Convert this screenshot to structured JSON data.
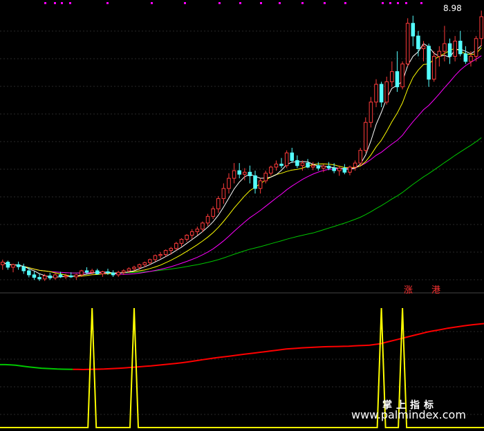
{
  "chart_data": {
    "type": "candlestick",
    "title": "",
    "grid": true,
    "colors": {
      "up": "#ff3b3b",
      "down": "#54ffff",
      "ma5": "#ffffff",
      "ma10": "#ffff00",
      "ma20": "#ff00ff",
      "ma60": "#00c800",
      "indicator_signal": "#ffff00",
      "indicator_line_up": "#ff0000",
      "indicator_line_low": "#00c800",
      "grid": "#2a2a2a"
    },
    "price_label": "8.98",
    "tags": [
      "涨",
      "港"
    ],
    "watermark": {
      "line1": "掌上指标",
      "line2": "www.palmindex.com"
    },
    "price_panel": {
      "y_range": [
        3.6,
        9.2
      ],
      "candles": [
        [
          4.1,
          4.2,
          4.0,
          4.15
        ],
        [
          4.15,
          4.18,
          4.0,
          4.05
        ],
        [
          4.05,
          4.12,
          3.95,
          4.1
        ],
        [
          4.1,
          4.16,
          4.0,
          4.06
        ],
        [
          4.06,
          4.12,
          3.92,
          3.98
        ],
        [
          3.98,
          4.05,
          3.85,
          3.9
        ],
        [
          3.9,
          3.97,
          3.8,
          3.85
        ],
        [
          3.85,
          3.92,
          3.78,
          3.82
        ],
        [
          3.82,
          3.92,
          3.78,
          3.88
        ],
        [
          3.88,
          3.94,
          3.8,
          3.84
        ],
        [
          3.84,
          3.93,
          3.8,
          3.9
        ],
        [
          3.9,
          3.96,
          3.84,
          3.86
        ],
        [
          3.86,
          3.92,
          3.82,
          3.88
        ],
        [
          3.88,
          3.95,
          3.84,
          3.86
        ],
        [
          3.86,
          3.92,
          3.8,
          3.9
        ],
        [
          3.9,
          4.0,
          3.86,
          3.98
        ],
        [
          3.98,
          4.05,
          3.92,
          3.95
        ],
        [
          3.95,
          4.02,
          3.9,
          3.98
        ],
        [
          3.98,
          4.02,
          3.9,
          3.92
        ],
        [
          3.92,
          3.98,
          3.86,
          3.96
        ],
        [
          3.96,
          4.02,
          3.9,
          3.94
        ],
        [
          3.94,
          3.99,
          3.86,
          3.9
        ],
        [
          3.9,
          3.98,
          3.86,
          3.95
        ],
        [
          3.95,
          4.01,
          3.9,
          3.98
        ],
        [
          3.98,
          4.05,
          3.94,
          4.02
        ],
        [
          4.02,
          4.08,
          3.98,
          4.05
        ],
        [
          4.05,
          4.12,
          4.0,
          4.1
        ],
        [
          4.1,
          4.16,
          4.05,
          4.14
        ],
        [
          4.14,
          4.22,
          4.1,
          4.2
        ],
        [
          4.2,
          4.3,
          4.16,
          4.28
        ],
        [
          4.28,
          4.35,
          4.22,
          4.3
        ],
        [
          4.3,
          4.4,
          4.26,
          4.38
        ],
        [
          4.38,
          4.45,
          4.3,
          4.42
        ],
        [
          4.42,
          4.55,
          4.38,
          4.52
        ],
        [
          4.52,
          4.62,
          4.46,
          4.6
        ],
        [
          4.6,
          4.7,
          4.55,
          4.68
        ],
        [
          4.68,
          4.8,
          4.6,
          4.75
        ],
        [
          4.75,
          4.85,
          4.68,
          4.8
        ],
        [
          4.8,
          4.95,
          4.74,
          4.92
        ],
        [
          4.92,
          5.1,
          4.86,
          5.05
        ],
        [
          5.05,
          5.25,
          5.0,
          5.2
        ],
        [
          5.2,
          5.45,
          5.12,
          5.4
        ],
        [
          5.4,
          5.7,
          5.3,
          5.6
        ],
        [
          5.6,
          5.9,
          5.5,
          5.8
        ],
        [
          5.8,
          6.1,
          5.7,
          5.95
        ],
        [
          5.95,
          6.1,
          5.8,
          5.88
        ],
        [
          5.88,
          6.0,
          5.76,
          5.92
        ],
        [
          5.92,
          6.05,
          5.7,
          5.85
        ],
        [
          5.85,
          5.95,
          5.5,
          5.6
        ],
        [
          5.6,
          5.8,
          5.5,
          5.75
        ],
        [
          5.75,
          5.95,
          5.7,
          5.9
        ],
        [
          5.9,
          6.05,
          5.85,
          6.02
        ],
        [
          6.02,
          6.15,
          5.95,
          6.08
        ],
        [
          6.08,
          6.2,
          6.0,
          6.05
        ],
        [
          6.05,
          6.35,
          6.0,
          6.3
        ],
        [
          6.3,
          6.4,
          6.1,
          6.15
        ],
        [
          6.15,
          6.25,
          6.0,
          6.05
        ],
        [
          6.05,
          6.15,
          5.95,
          6.1
        ],
        [
          6.1,
          6.18,
          6.0,
          6.02
        ],
        [
          6.02,
          6.12,
          5.96,
          6.05
        ],
        [
          6.05,
          6.12,
          5.95,
          6.0
        ],
        [
          6.0,
          6.08,
          5.92,
          6.04
        ],
        [
          6.04,
          6.12,
          5.96,
          6.0
        ],
        [
          6.0,
          6.1,
          5.9,
          5.95
        ],
        [
          5.95,
          6.05,
          5.85,
          6.0
        ],
        [
          6.0,
          6.08,
          5.88,
          5.92
        ],
        [
          5.92,
          6.05,
          5.86,
          6.02
        ],
        [
          6.02,
          6.15,
          5.95,
          6.1
        ],
        [
          6.1,
          6.4,
          6.05,
          6.35
        ],
        [
          6.35,
          7.0,
          6.3,
          6.9
        ],
        [
          6.9,
          7.4,
          6.8,
          7.3
        ],
        [
          7.3,
          7.75,
          7.2,
          7.65
        ],
        [
          7.65,
          7.7,
          7.2,
          7.3
        ],
        [
          7.3,
          7.8,
          7.25,
          7.7
        ],
        [
          7.7,
          8.1,
          7.6,
          7.9
        ],
        [
          7.9,
          8.3,
          7.5,
          7.6
        ],
        [
          7.6,
          8.1,
          7.55,
          8.05
        ],
        [
          8.05,
          8.95,
          8.0,
          8.85
        ],
        [
          8.85,
          9.0,
          8.4,
          8.6
        ],
        [
          8.6,
          8.7,
          8.2,
          8.35
        ],
        [
          8.35,
          8.5,
          8.1,
          8.4
        ],
        [
          8.4,
          8.45,
          7.6,
          7.75
        ],
        [
          7.75,
          8.3,
          7.7,
          8.2
        ],
        [
          8.2,
          8.4,
          8.0,
          8.3
        ],
        [
          8.3,
          8.8,
          8.1,
          8.45
        ],
        [
          8.45,
          8.55,
          8.05,
          8.2
        ],
        [
          8.2,
          8.6,
          8.1,
          8.5
        ],
        [
          8.5,
          8.7,
          8.2,
          8.25
        ],
        [
          8.25,
          8.4,
          8.05,
          8.1
        ],
        [
          8.1,
          8.3,
          8.0,
          8.2
        ],
        [
          8.2,
          8.6,
          8.1,
          8.55
        ],
        [
          8.55,
          9.1,
          8.4,
          8.98
        ]
      ]
    },
    "indicator_panel": {
      "y_range": [
        0,
        100
      ],
      "signal_spikes": [
        17,
        25,
        72,
        76
      ],
      "line": [
        49,
        49,
        48.8,
        48.5,
        48,
        47.5,
        47,
        46.6,
        46.2,
        46,
        45.8,
        45.6,
        45.5,
        45.4,
        45.3,
        45.3,
        45.2,
        45.3,
        45.4,
        45.5,
        45.6,
        45.8,
        46,
        46.2,
        46.5,
        46.8,
        47.1,
        47.4,
        47.7,
        48,
        48.4,
        48.8,
        49.2,
        49.6,
        50,
        50.5,
        51,
        51.6,
        52.2,
        52.8,
        53.4,
        54,
        54.5,
        55,
        55.5,
        56,
        56.5,
        57,
        57.5,
        58,
        58.5,
        59,
        59.5,
        60,
        60.5,
        61,
        61.3,
        61.6,
        61.9,
        62.1,
        62.3,
        62.5,
        62.7,
        62.8,
        62.9,
        63,
        63.1,
        63.2,
        63.4,
        63.6,
        63.8,
        64,
        64.5,
        65,
        66,
        67,
        68,
        69,
        70,
        71,
        72,
        73,
        74,
        74.8,
        75.5,
        76.2,
        77,
        77.6,
        78.2,
        78.8,
        79.3,
        79.8,
        80.2,
        80.6
      ]
    }
  }
}
